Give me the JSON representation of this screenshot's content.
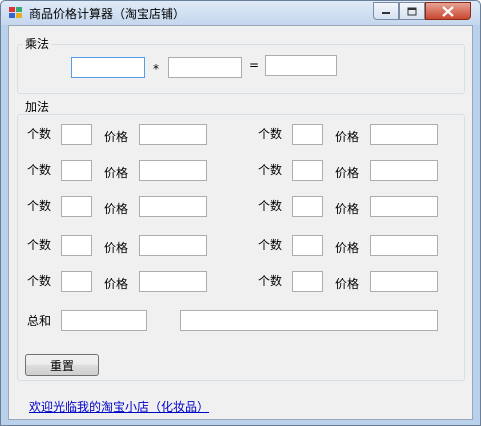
{
  "window": {
    "title": "商品价格计算器（淘宝店铺）",
    "controls": {
      "minimize_icon": "minimize-icon",
      "maximize_icon": "maximize-icon",
      "close_icon": "close-icon"
    }
  },
  "multiply": {
    "legend": "乘法",
    "operand1": "",
    "times_symbol": "*",
    "operand2": "",
    "equals_symbol": "=",
    "result": ""
  },
  "add": {
    "legend": "加法",
    "count_label": "个数",
    "price_label": "价格",
    "rows": [
      {
        "left_count": "",
        "left_price": "",
        "right_count": "",
        "right_price": ""
      },
      {
        "left_count": "",
        "left_price": "",
        "right_count": "",
        "right_price": ""
      },
      {
        "left_count": "",
        "left_price": "",
        "right_count": "",
        "right_price": ""
      },
      {
        "left_count": "",
        "left_price": "",
        "right_count": "",
        "right_price": ""
      },
      {
        "left_count": "",
        "left_price": "",
        "right_count": "",
        "right_price": ""
      }
    ],
    "total_label": "总和",
    "total_value": "",
    "total_detail": "",
    "reset_label": "重置"
  },
  "footer": {
    "link_text": "欢迎光临我的淘宝小店（化妆品）"
  },
  "colors": {
    "title_bar": "#c4d7ee",
    "client_bg": "#f0f0f0",
    "close_button": "#c9472f",
    "link": "#0000c8",
    "focus_border": "#569de5"
  }
}
